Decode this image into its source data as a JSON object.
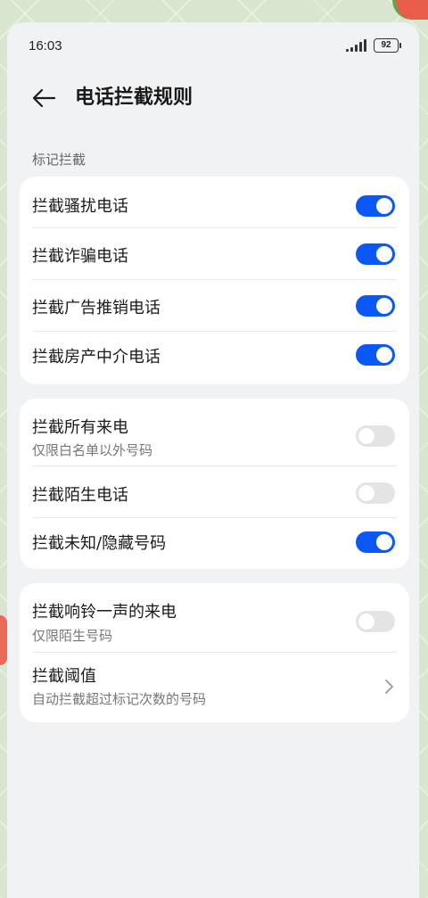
{
  "status_bar": {
    "time": "16:03",
    "battery": "92"
  },
  "header": {
    "title": "电话拦截规则"
  },
  "section": {
    "label": "标记拦截"
  },
  "card1": {
    "rows": [
      {
        "title": "拦截骚扰电话",
        "toggle": "on"
      },
      {
        "title": "拦截诈骗电话",
        "toggle": "on"
      },
      {
        "title": "拦截广告推销电话",
        "toggle": "on"
      },
      {
        "title": "拦截房产中介电话",
        "toggle": "on"
      }
    ]
  },
  "card2": {
    "rows": [
      {
        "title": "拦截所有来电",
        "subtitle": "仅限白名单以外号码",
        "toggle": "off"
      },
      {
        "title": "拦截陌生电话",
        "toggle": "off"
      },
      {
        "title": "拦截未知/隐藏号码",
        "toggle": "on"
      }
    ]
  },
  "card3": {
    "rows": [
      {
        "title": "拦截响铃一声的来电",
        "subtitle": "仅限陌生号码",
        "toggle": "off"
      },
      {
        "title": "拦截阈值",
        "subtitle": "自动拦截超过标记次数的号码"
      }
    ]
  },
  "colors": {
    "accent": "#0a59f7",
    "toggle_off": "#e4e4e6",
    "background": "#f1f2f4"
  }
}
